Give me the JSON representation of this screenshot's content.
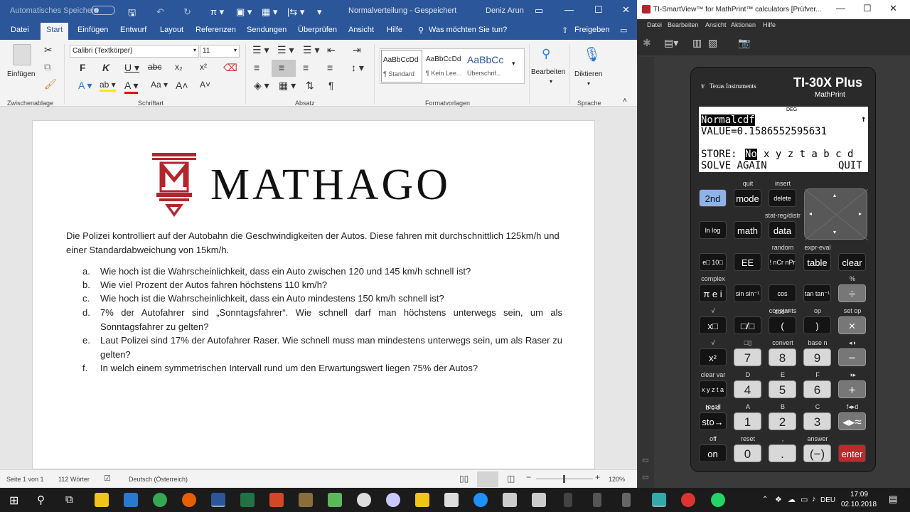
{
  "word": {
    "autosave_label": "Automatisches Speichern",
    "autosave_state": "Aus",
    "doc_title": "Normalverteilung  -  Gespeichert",
    "user": "Deniz Arun",
    "tabs": [
      "Datei",
      "Start",
      "Einfügen",
      "Entwurf",
      "Layout",
      "Referenzen",
      "Sendungen",
      "Überprüfen",
      "Ansicht",
      "Hilfe"
    ],
    "active_tab": "Start",
    "tell_me": "Was möchten Sie tun?",
    "share": "Freigeben",
    "clipboard": {
      "paste": "Einfügen",
      "group": "Zwischenablage"
    },
    "font": {
      "name": "Calibri (Textkörper)",
      "size": "11",
      "group": "Schriftart"
    },
    "paragraph_group": "Absatz",
    "styles": {
      "items": [
        {
          "preview": "AaBbCcDd",
          "label": "¶ Standard"
        },
        {
          "preview": "AaBbCcDd",
          "label": "¶ Kein Lee..."
        },
        {
          "preview": "AaBbCc",
          "label": "Überschrif..."
        }
      ],
      "group": "Formatvorlagen"
    },
    "edit": {
      "label": "Bearbeiten"
    },
    "dictate": {
      "label": "Diktieren",
      "group": "Sprache"
    },
    "document": {
      "logo_text": "MATHAGO",
      "intro": "Die Polizei kontrolliert auf der Autobahn die Geschwindigkeiten der Autos. Diese fahren mit durchschnittlich 125km/h und einer Standardabweichung von 15km/h.",
      "items": [
        {
          "marker": "a.",
          "text": "Wie hoch ist die Wahrscheinlichkeit, dass ein Auto zwischen 120 und 145 km/h schnell ist?"
        },
        {
          "marker": "b.",
          "text": "Wie viel Prozent der Autos fahren höchstens 110 km/h?"
        },
        {
          "marker": "c.",
          "text": "Wie hoch ist die Wahrscheinlichkeit, dass ein Auto mindestens 150 km/h schnell ist?"
        },
        {
          "marker": "d.",
          "text": "7% der Autofahrer sind „Sonntagsfahrer“. Wie schnell darf man höchstens unterwegs sein, um als Sonntagsfahrer zu gelten?"
        },
        {
          "marker": "e.",
          "text": "Laut Polizei sind 17% der Autofahrer Raser. Wie schnell muss man mindestens unterwegs sein, um als Raser zu gelten?"
        },
        {
          "marker": "f.",
          "text": "In welch einem symmetrischen Intervall rund um den Erwartungswert liegen 75% der Autos?"
        }
      ]
    },
    "status": {
      "page": "Seite 1 von 1",
      "words": "112 Wörter",
      "language": "Deutsch (Österreich)",
      "zoom": "120%"
    }
  },
  "ti": {
    "window_title": "TI-SmartView™ for MathPrint™ calculators [Prüfver...",
    "menu": [
      "Datei",
      "Bearbeiten",
      "Ansicht",
      "Aktionen",
      "Hilfe"
    ],
    "brand": "Texas Instruments",
    "model": "TI-30X Plus",
    "model_sub": "MathPrint",
    "screen": {
      "mode": "DEG",
      "line1": "Normalcdf",
      "line2": "VALUE=0.1586552595631",
      "line3_prefix": "STORE:",
      "line3_selected": "No",
      "line3_vars": "x y z t a b c d",
      "line4_left": "SOLVE AGAIN",
      "line4_right": "QUIT"
    },
    "keys": [
      {
        "row": 0,
        "col": 0,
        "label": "2nd",
        "style": "blue",
        "top": ""
      },
      {
        "row": 0,
        "col": 1,
        "label": "mode",
        "style": "dark",
        "top": "quit"
      },
      {
        "row": 0,
        "col": 2,
        "label": "delete",
        "style": "dark",
        "top": "insert"
      },
      {
        "row": 1,
        "col": 0,
        "label": "ln log",
        "style": "dark",
        "top": ""
      },
      {
        "row": 1,
        "col": 1,
        "label": "math",
        "style": "dark",
        "top": ""
      },
      {
        "row": 1,
        "col": 2,
        "label": "data",
        "style": "dark",
        "top": "stat-reg/distr"
      },
      {
        "row": 2,
        "col": 0,
        "label": "e□ 10□",
        "style": "dark",
        "top": ""
      },
      {
        "row": 2,
        "col": 1,
        "label": "EE",
        "style": "dark",
        "top": ""
      },
      {
        "row": 2,
        "col": 2,
        "label": "! nCr nPr",
        "style": "dark",
        "top": "random"
      },
      {
        "row": 2,
        "col": 3,
        "label": "table",
        "style": "dark",
        "top": "expr-eval"
      },
      {
        "row": 2,
        "col": 4,
        "label": "clear",
        "style": "dark",
        "top": ""
      },
      {
        "row": 3,
        "col": 0,
        "label": "π e i",
        "style": "dark",
        "top": "complex"
      },
      {
        "row": 3,
        "col": 1,
        "label": "sin sin⁻¹",
        "style": "dark",
        "top": ""
      },
      {
        "row": 3,
        "col": 2,
        "label": "cos cos⁻¹",
        "style": "dark",
        "top": ""
      },
      {
        "row": 3,
        "col": 3,
        "label": "tan tan⁻¹",
        "style": "dark",
        "top": ""
      },
      {
        "row": 3,
        "col": 4,
        "label": "÷",
        "style": "op",
        "top": "%"
      },
      {
        "row": 4,
        "col": 0,
        "label": "x□",
        "style": "dark",
        "top": "√"
      },
      {
        "row": 4,
        "col": 1,
        "label": "□/□",
        "style": "dark",
        "top": ""
      },
      {
        "row": 4,
        "col": 2,
        "label": "(",
        "style": "dark",
        "top": "constants"
      },
      {
        "row": 4,
        "col": 3,
        "label": ")",
        "style": "dark",
        "top": "op"
      },
      {
        "row": 4,
        "col": 4,
        "label": "×",
        "style": "op",
        "top": "set op"
      },
      {
        "row": 5,
        "col": 0,
        "label": "x²",
        "style": "dark",
        "top": "√"
      },
      {
        "row": 5,
        "col": 1,
        "label": "7",
        "style": "gray",
        "top": "□▯"
      },
      {
        "row": 5,
        "col": 2,
        "label": "8",
        "style": "gray",
        "top": "convert"
      },
      {
        "row": 5,
        "col": 3,
        "label": "9",
        "style": "gray",
        "top": "base n"
      },
      {
        "row": 5,
        "col": 4,
        "label": "−",
        "style": "op",
        "top": "◂◑"
      },
      {
        "row": 6,
        "col": 0,
        "label": "x y z t a b c d",
        "style": "dark",
        "top": "clear var"
      },
      {
        "row": 6,
        "col": 1,
        "label": "4",
        "style": "gray",
        "top": "D"
      },
      {
        "row": 6,
        "col": 2,
        "label": "5",
        "style": "gray",
        "top": "E"
      },
      {
        "row": 6,
        "col": 3,
        "label": "6",
        "style": "gray",
        "top": "F"
      },
      {
        "row": 6,
        "col": 4,
        "label": "+",
        "style": "op",
        "top": "◑▸"
      },
      {
        "row": 7,
        "col": 0,
        "label": "sto→",
        "style": "dark",
        "top": "recall"
      },
      {
        "row": 7,
        "col": 1,
        "label": "1",
        "style": "gray",
        "top": "A"
      },
      {
        "row": 7,
        "col": 2,
        "label": "2",
        "style": "gray",
        "top": "B"
      },
      {
        "row": 7,
        "col": 3,
        "label": "3",
        "style": "gray",
        "top": "C"
      },
      {
        "row": 7,
        "col": 4,
        "label": "◂▸≈",
        "style": "op",
        "top": "f◂▸d"
      },
      {
        "row": 8,
        "col": 0,
        "label": "on",
        "style": "dark",
        "top": "off"
      },
      {
        "row": 8,
        "col": 1,
        "label": "0",
        "style": "gray",
        "top": "reset"
      },
      {
        "row": 8,
        "col": 2,
        "label": ".",
        "style": "gray",
        "top": ","
      },
      {
        "row": 8,
        "col": 3,
        "label": "(−)",
        "style": "gray",
        "top": "answer"
      },
      {
        "row": 8,
        "col": 4,
        "label": "enter",
        "style": "red",
        "top": ""
      }
    ]
  },
  "taskbar": {
    "language": "DEU",
    "time": "17:09",
    "date": "02.10.2018"
  },
  "colors": {
    "word_blue": "#2b579a",
    "enter_red": "#c0282b",
    "second_blue": "#8fb3e6"
  }
}
